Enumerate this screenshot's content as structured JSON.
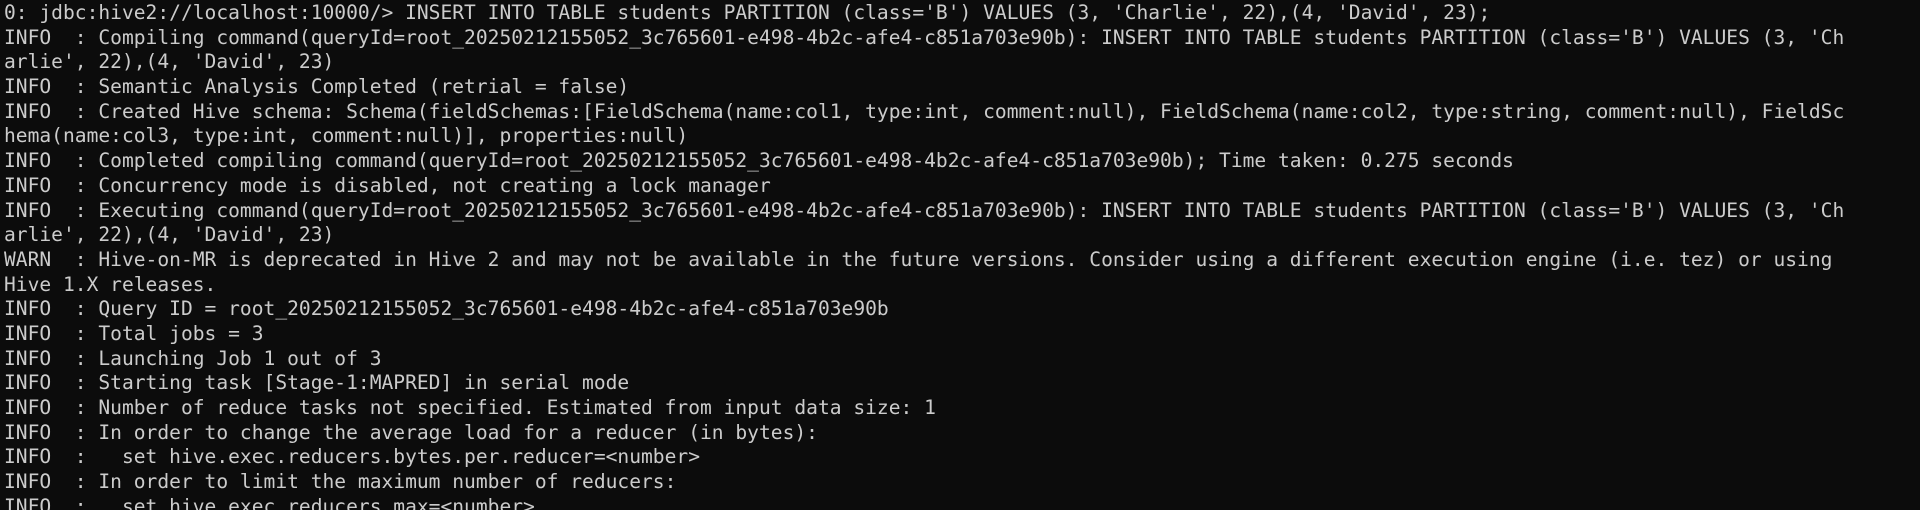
{
  "terminal": {
    "lines": [
      "0: jdbc:hive2://localhost:10000/> INSERT INTO TABLE students PARTITION (class='B') VALUES (3, 'Charlie', 22),(4, 'David', 23);",
      "INFO  : Compiling command(queryId=root_20250212155052_3c765601-e498-4b2c-afe4-c851a703e90b): INSERT INTO TABLE students PARTITION (class='B') VALUES (3, 'Ch",
      "arlie', 22),(4, 'David', 23)",
      "INFO  : Semantic Analysis Completed (retrial = false)",
      "INFO  : Created Hive schema: Schema(fieldSchemas:[FieldSchema(name:col1, type:int, comment:null), FieldSchema(name:col2, type:string, comment:null), FieldSc",
      "hema(name:col3, type:int, comment:null)], properties:null)",
      "INFO  : Completed compiling command(queryId=root_20250212155052_3c765601-e498-4b2c-afe4-c851a703e90b); Time taken: 0.275 seconds",
      "INFO  : Concurrency mode is disabled, not creating a lock manager",
      "INFO  : Executing command(queryId=root_20250212155052_3c765601-e498-4b2c-afe4-c851a703e90b): INSERT INTO TABLE students PARTITION (class='B') VALUES (3, 'Ch",
      "arlie', 22),(4, 'David', 23)",
      "WARN  : Hive-on-MR is deprecated in Hive 2 and may not be available in the future versions. Consider using a different execution engine (i.e. tez) or using",
      "Hive 1.X releases.",
      "INFO  : Query ID = root_20250212155052_3c765601-e498-4b2c-afe4-c851a703e90b",
      "INFO  : Total jobs = 3",
      "INFO  : Launching Job 1 out of 3",
      "INFO  : Starting task [Stage-1:MAPRED] in serial mode",
      "INFO  : Number of reduce tasks not specified. Estimated from input data size: 1",
      "INFO  : In order to change the average load for a reducer (in bytes):",
      "INFO  :   set hive.exec.reducers.bytes.per.reducer=<number>",
      "INFO  : In order to limit the maximum number of reducers:",
      "INFO  :   set hive.exec.reducers.max=<number>"
    ]
  }
}
